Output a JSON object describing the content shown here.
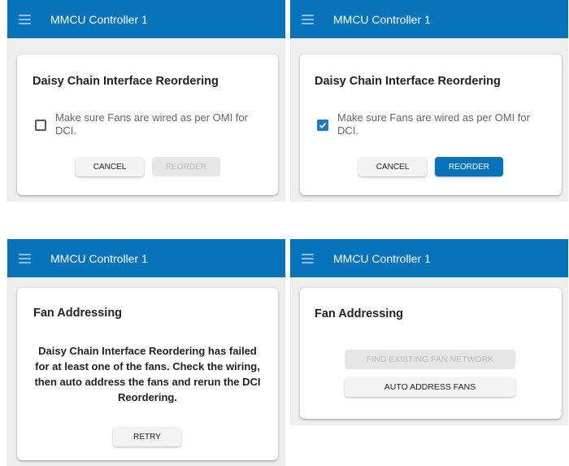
{
  "app": {
    "title": "MMCU Controller 1"
  },
  "dci_dialog": {
    "title": "Daisy Chain Interface Reordering",
    "checkbox_label": "Make sure Fans are wired as per OMI for DCI.",
    "cancel_label": "CANCEL",
    "reorder_label": "REORDER"
  },
  "fan_addressing": {
    "title": "Fan Addressing",
    "failure_message": "Daisy Chain Interface Reordering has failed for at least one of the fans. Check the wiring, then auto address the fans and rerun the DCI Reordering.",
    "retry_label": "RETRY",
    "find_network_label": "FIND EXISTING FAN NETWORK",
    "auto_address_label": "AUTO ADDRESS FANS"
  },
  "states": {
    "panel1": {
      "checkbox_checked": false,
      "reorder_enabled": false
    },
    "panel2": {
      "checkbox_checked": true,
      "reorder_enabled": true
    },
    "panel4": {
      "find_network_enabled": false,
      "auto_address_enabled": true
    }
  },
  "colors": {
    "appbar": "#0773bb",
    "primary_button": "#0773bb",
    "checkbox_checked": "#1f79bd",
    "panel_background": "#eeeeee"
  }
}
